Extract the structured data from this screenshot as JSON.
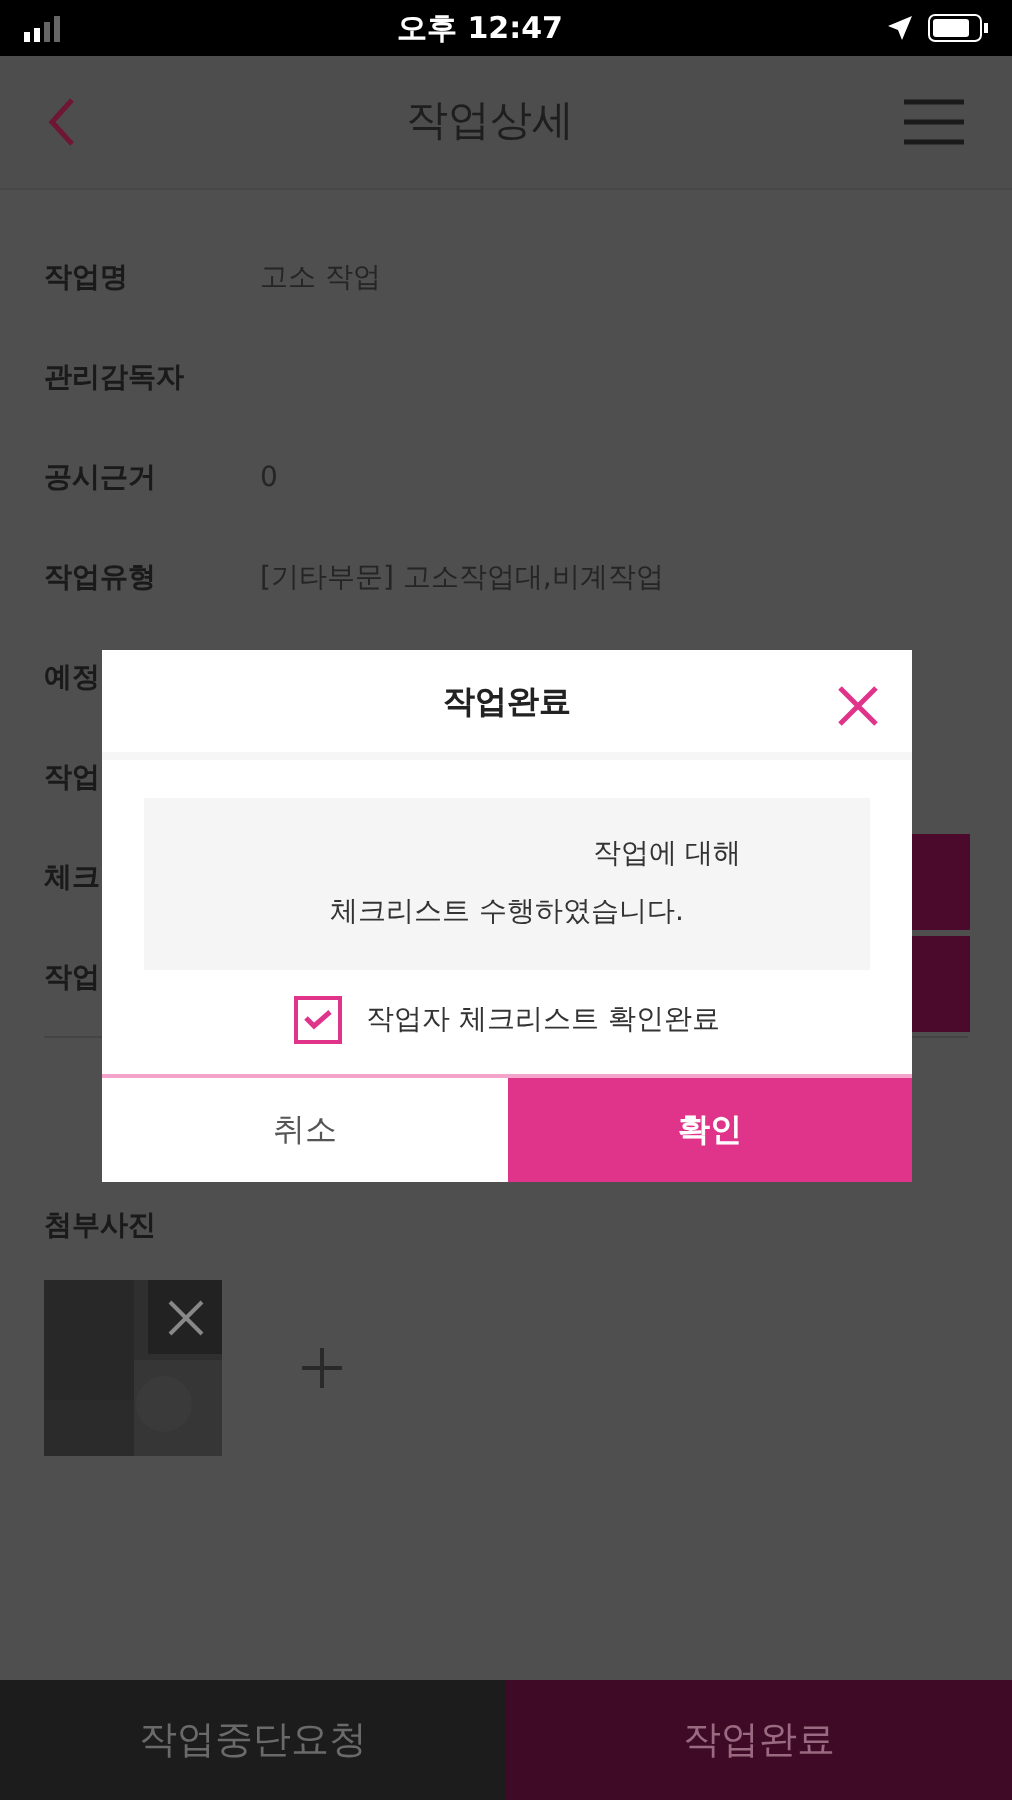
{
  "status_bar": {
    "time": "오후 12:47"
  },
  "header": {
    "title": "작업상세"
  },
  "fields": [
    {
      "label": "작업명",
      "value": "고소 작업"
    },
    {
      "label": "관리감독자"
    },
    {
      "label": "공시근거",
      "value": "0"
    },
    {
      "label": "작업유형",
      "value": "[기타부문] 고소작업대,비계작업"
    },
    {
      "label": "예정"
    },
    {
      "label": "작업"
    },
    {
      "label": "체크"
    },
    {
      "label": "작업"
    }
  ],
  "attachments": {
    "title": "첨부사진"
  },
  "modal": {
    "title": "작업완료",
    "message_lines": [
      "작업에 대해",
      "체크리스트 수행하였습니다."
    ],
    "checkbox": {
      "label": "작업자 체크리스트 확인완료",
      "checked": true
    },
    "buttons": [
      {
        "label": "취소",
        "kind": "cancel"
      },
      {
        "label": "확인",
        "kind": "confirm"
      }
    ]
  },
  "bottom_buttons": [
    {
      "label": "작업중단요청",
      "kind": "secondary"
    },
    {
      "label": "작업완료",
      "kind": "primary"
    }
  ]
}
